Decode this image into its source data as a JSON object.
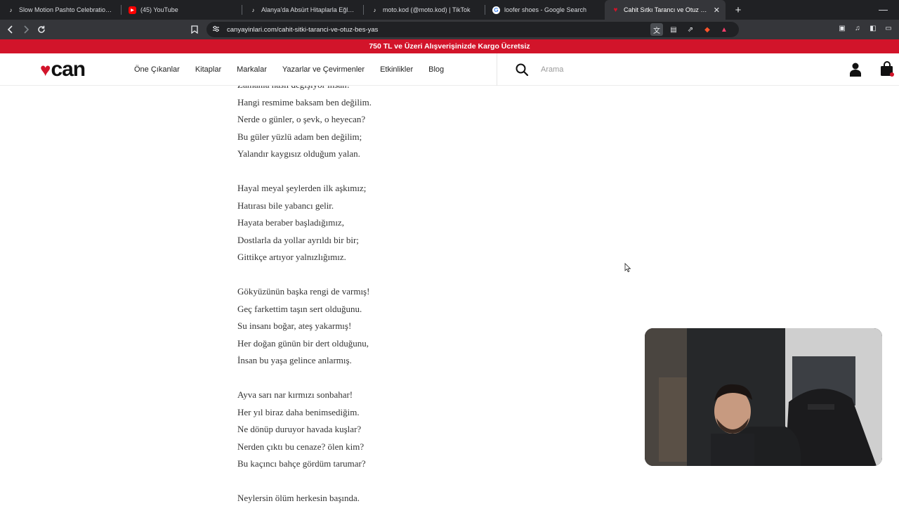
{
  "browser": {
    "tabs": [
      {
        "title": "Slow Motion Pashto Celebration Vide",
        "icon": "tiktok-icon"
      },
      {
        "title": "(45) YouTube",
        "icon": "youtube-icon"
      },
      {
        "title": "Alanya'da Absürt Hitaplarla Eğlenceli",
        "icon": "tiktok-icon"
      },
      {
        "title": "moto.kod (@moto.kod) | TikTok",
        "icon": "tiktok-icon"
      },
      {
        "title": "loofer shoes - Google Search",
        "icon": "google-icon"
      },
      {
        "title": "Cahit Sıtkı Tarancı ve Otuz Beş Ya",
        "icon": "can-heart-icon",
        "active": true
      }
    ],
    "url": "canyayinlari.com/cahit-sitki-taranci-ve-otuz-bes-yas",
    "colors": {
      "tabstrip": "#202124",
      "toolbar": "#35363a"
    }
  },
  "site": {
    "promo": "750 TL ve Üzeri Alışverişinizde Kargo Ücretsiz",
    "logo_text": "can",
    "nav": [
      "Öne Çıkanlar",
      "Kitaplar",
      "Markalar",
      "Yazarlar ve Çevirmenler",
      "Etkinlikler",
      "Blog"
    ],
    "search": {
      "placeholder": "Arama"
    },
    "colors": {
      "brand": "#d2142a"
    }
  },
  "poem": {
    "stanzas": [
      [
        "Zamanla nasıl değişiyor insan!",
        "Hangi resmime baksam ben değilim.",
        "Nerde o günler, o şevk, o heyecan?",
        "Bu güler yüzlü adam ben değilim;",
        "Yalandır kaygısız olduğum yalan."
      ],
      [
        "Hayal meyal şeylerden ilk aşkımız;",
        "Hatırası bile yabancı gelir.",
        "Hayata beraber başladığımız,",
        "Dostlarla da yollar ayrıldı bir bir;",
        "Gittikçe artıyor yalnızlığımız."
      ],
      [
        "Gökyüzünün başka rengi de varmış!",
        "Geç farkettim taşın sert olduğunu.",
        "Su insanı boğar, ateş yakarmış!",
        "Her doğan günün bir dert olduğunu,",
        "İnsan bu yaşa gelince anlarmış."
      ],
      [
        "Ayva sarı nar kırmızı sonbahar!",
        "Her yıl biraz daha benimsediğim.",
        "Ne dönüp duruyor havada kuşlar?",
        "Nerden çıktı bu cenaze? ölen kim?",
        "Bu kaçıncı bahçe gördüm tarumar?"
      ],
      [
        "Neylersin ölüm herkesin başında."
      ]
    ]
  }
}
